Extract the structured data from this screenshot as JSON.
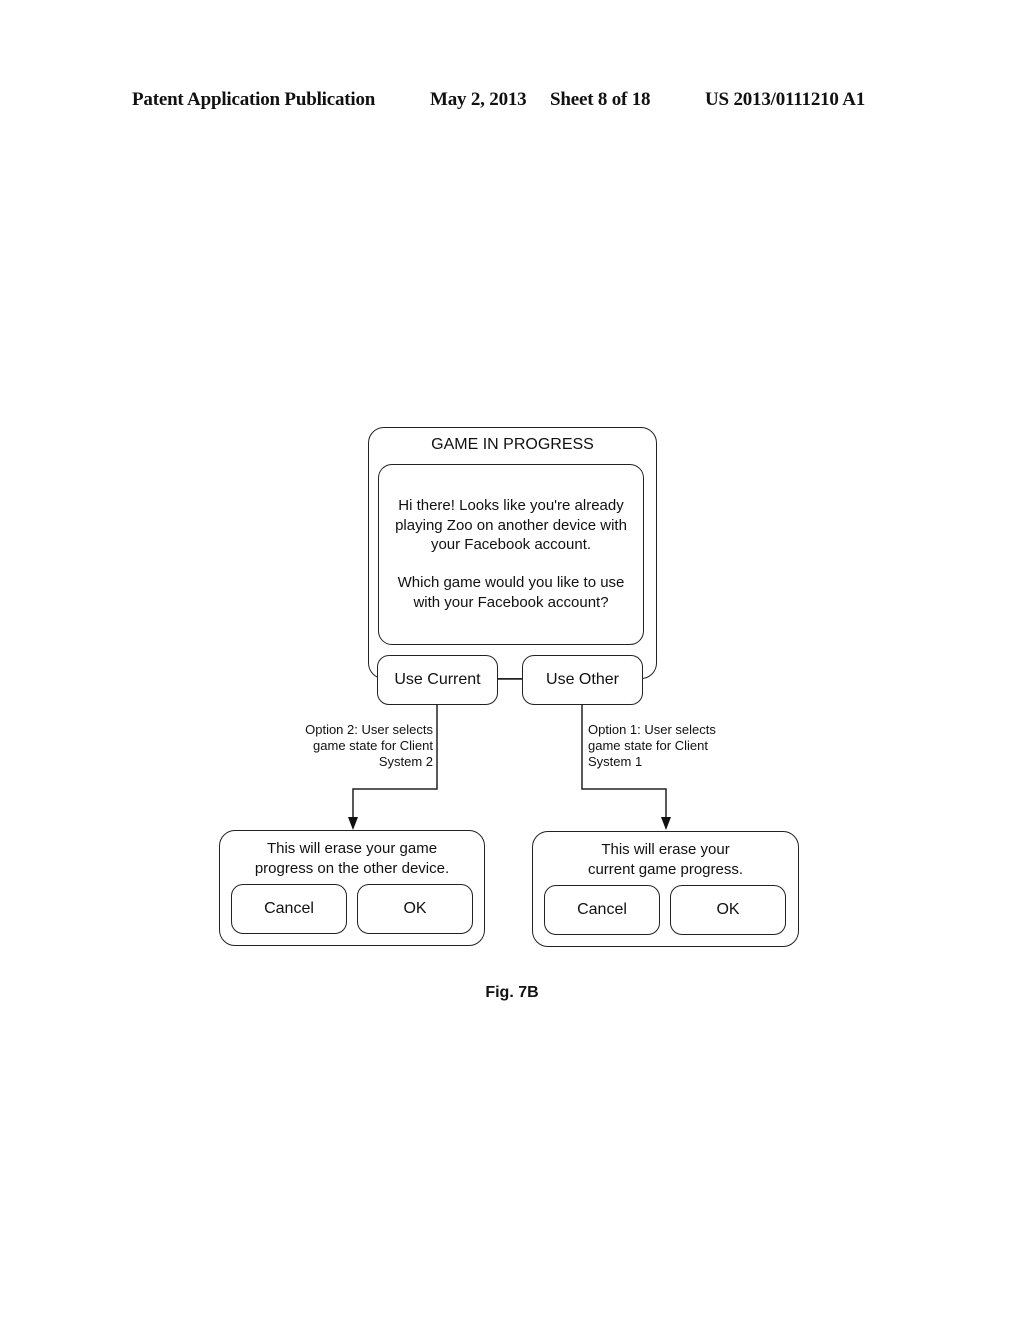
{
  "header": {
    "publication": "Patent Application Publication",
    "date": "May 2, 2013",
    "sheet": "Sheet 8 of 18",
    "patent_number": "US 2013/0111210 A1"
  },
  "main_dialog": {
    "title": "GAME IN PROGRESS",
    "message_lines": [
      "Hi there! Looks like you're already",
      "playing Zoo on another device with",
      "your Facebook account."
    ],
    "question_lines": [
      "Which game would you like to use",
      "with your Facebook account?"
    ],
    "use_current_label": "Use Current",
    "use_other_label": "Use Other"
  },
  "option2": {
    "lines": [
      "Option 2: User selects",
      "game state for Client",
      "System 2"
    ]
  },
  "option1": {
    "lines": [
      "Option 1: User selects",
      "game state for Client",
      "System 1"
    ]
  },
  "left_confirm": {
    "lines": [
      "This will erase your game",
      "progress on the other device."
    ],
    "cancel_label": "Cancel",
    "ok_label": "OK"
  },
  "right_confirm": {
    "lines": [
      "This will erase your",
      "current game progress."
    ],
    "cancel_label": "Cancel",
    "ok_label": "OK"
  },
  "figure_label": "Fig. 7B"
}
